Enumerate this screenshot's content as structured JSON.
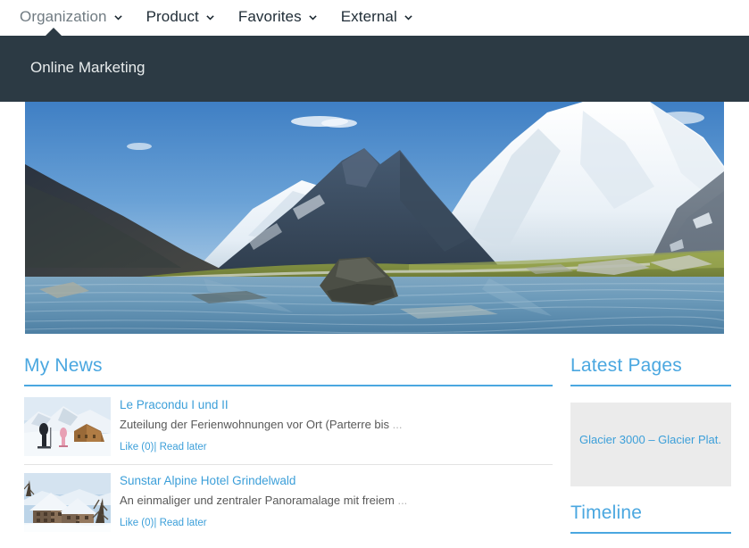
{
  "topnav": {
    "items": [
      {
        "label": "Organization",
        "icon": "chevron-down-icon",
        "active": true
      },
      {
        "label": "Product",
        "icon": "chevron-down-icon",
        "active": false
      },
      {
        "label": "Favorites",
        "icon": "chevron-down-icon",
        "active": false
      },
      {
        "label": "External",
        "icon": "chevron-down-icon",
        "active": false
      }
    ]
  },
  "dropdown": {
    "open_for": "Organization",
    "entry_label": "Online Marketing",
    "background": "#2c3a44"
  },
  "hero": {
    "alt": "Alpine lake with snow-capped mountains"
  },
  "main": {
    "news_heading": "My News",
    "news_items": [
      {
        "title": "Le Pracondu I und II",
        "description": "Zuteilung der Ferienwohnungen vor Ort (Parterre bis",
        "ellipsis": "...",
        "like_label": "Like (0)",
        "separator": "|",
        "read_later_label": "Read later",
        "thumb": "skiers-on-slope-thumbnail"
      },
      {
        "title": "Sunstar Alpine Hotel Grindelwald",
        "description": "An einmaliger und zentraler Panoramalage mit freiem",
        "ellipsis": "...",
        "like_label": "Like (0)",
        "separator": "|",
        "read_later_label": "Read later",
        "thumb": "snowy-hotel-thumbnail"
      }
    ]
  },
  "sidebar": {
    "latest_pages_heading": "Latest Pages",
    "latest_pages_items": [
      {
        "label": "Glacier 3000 – Glacier Plat..."
      }
    ],
    "timeline_heading": "Timeline"
  },
  "colors": {
    "accent_blue": "#4aa7e0",
    "link_blue": "#3c9fd9",
    "panel_dark": "#2c3a44",
    "card_gray": "#ebebeb",
    "nav_active": "#707b82",
    "nav_text": "#1f2c36"
  }
}
